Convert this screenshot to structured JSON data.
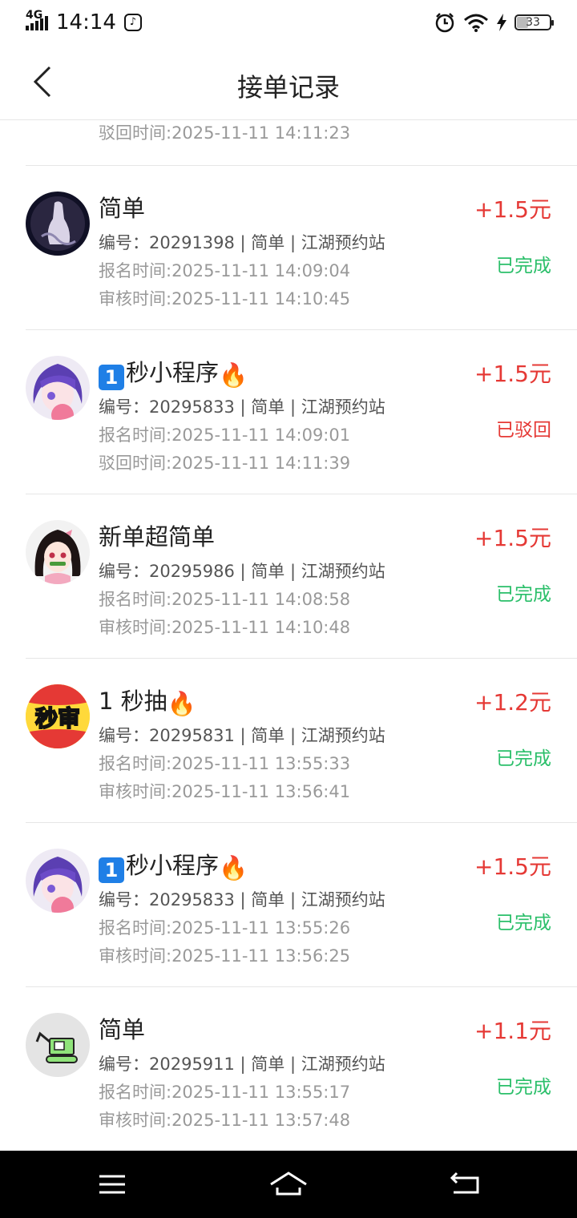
{
  "status_bar": {
    "network": "4G",
    "time": "14:14",
    "battery": "33"
  },
  "header": {
    "title": "接单记录"
  },
  "partial_row": {
    "line": "驳回时间:2025-11-11 14:11:23"
  },
  "orders": [
    {
      "title": "简单",
      "meta": "编号：20291398 | 简单 | 江湖预约站",
      "signup_time": "报名时间:2025-11-11 14:09:04",
      "second_time": "审核时间:2025-11-11 14:10:45",
      "amount": "+1.5元",
      "status": "已完成",
      "avatar_icon": "avatar-dark-figure"
    },
    {
      "title": "秒小程序",
      "title_prefix_icon": "keycap-1-icon",
      "title_suffix_icon": "fire-icon",
      "meta": "编号：20295833 | 简单 | 江湖预约站",
      "signup_time": "报名时间:2025-11-11 14:09:01",
      "second_time": "驳回时间:2025-11-11 14:11:39",
      "amount": "+1.5元",
      "status": "已驳回",
      "avatar_icon": "avatar-purple-hair"
    },
    {
      "title": "新单超简单",
      "meta": "编号：20295986 | 简单 | 江湖预约站",
      "signup_time": "报名时间:2025-11-11 14:08:58",
      "second_time": "审核时间:2025-11-11 14:10:48",
      "amount": "+1.5元",
      "status": "已完成",
      "avatar_icon": "avatar-anime-girl"
    },
    {
      "title": "1 秒抽",
      "title_suffix_icon": "fire-icon",
      "meta": "编号：20295831 | 简单 | 江湖预约站",
      "signup_time": "报名时间:2025-11-11 13:55:33",
      "second_time": "审核时间:2025-11-11 13:56:41",
      "amount": "+1.2元",
      "status": "已完成",
      "avatar_icon": "avatar-miaoshen",
      "avatar_text": "秒审"
    },
    {
      "title": "秒小程序",
      "title_prefix_icon": "keycap-1-icon",
      "title_suffix_icon": "fire-icon",
      "meta": "编号：20295833 | 简单 | 江湖预约站",
      "signup_time": "报名时间:2025-11-11 13:55:26",
      "second_time": "审核时间:2025-11-11 13:56:25",
      "amount": "+1.5元",
      "status": "已完成",
      "avatar_icon": "avatar-purple-hair"
    },
    {
      "title": "简单",
      "meta": "编号：20295911 | 简单 | 江湖预约站",
      "signup_time": "报名时间:2025-11-11 13:55:17",
      "second_time": "审核时间:2025-11-11 13:57:48",
      "amount": "+1.1元",
      "status": "已完成",
      "avatar_icon": "avatar-excavator"
    }
  ],
  "colors": {
    "amount": "#e53935",
    "status_done": "#2bbf6a",
    "status_rejected": "#e53935"
  }
}
